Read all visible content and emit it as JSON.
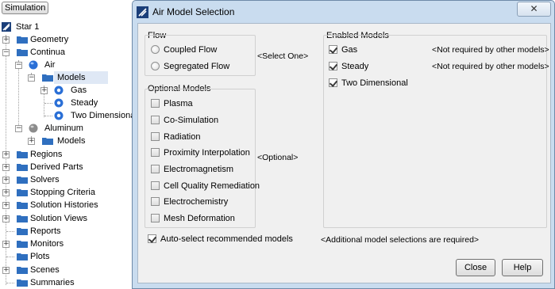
{
  "tree": {
    "sim_tab": "Simulation",
    "items": [
      {
        "label": "Star 1"
      },
      {
        "label": "Geometry"
      },
      {
        "label": "Continua"
      },
      {
        "label": "Air"
      },
      {
        "label": "Models"
      },
      {
        "label": "Gas"
      },
      {
        "label": "Steady"
      },
      {
        "label": "Two Dimensional"
      },
      {
        "label": "Aluminum"
      },
      {
        "label": "Models"
      },
      {
        "label": "Regions"
      },
      {
        "label": "Derived Parts"
      },
      {
        "label": "Solvers"
      },
      {
        "label": "Stopping Criteria"
      },
      {
        "label": "Solution Histories"
      },
      {
        "label": "Solution Views"
      },
      {
        "label": "Reports"
      },
      {
        "label": "Monitors"
      },
      {
        "label": "Plots"
      },
      {
        "label": "Scenes"
      },
      {
        "label": "Summaries"
      }
    ]
  },
  "dialog": {
    "title": "Air Model Selection",
    "close_glyph": "✕",
    "flow": {
      "title": "Flow",
      "options": [
        {
          "label": "Coupled Flow",
          "selected": false
        },
        {
          "label": "Segregated Flow",
          "selected": false
        }
      ],
      "hint": "<Select One>"
    },
    "optional": {
      "title": "Optional Models",
      "items": [
        {
          "label": "Plasma"
        },
        {
          "label": "Co-Simulation"
        },
        {
          "label": "Radiation"
        },
        {
          "label": "Proximity Interpolation"
        },
        {
          "label": "Electromagnetism"
        },
        {
          "label": "Cell Quality Remediation"
        },
        {
          "label": "Electrochemistry"
        },
        {
          "label": "Mesh Deformation"
        }
      ],
      "hint": "<Optional>"
    },
    "enabled": {
      "title": "Enabled Models",
      "items": [
        {
          "label": "Gas",
          "checked": true,
          "note": "<Not required by other models>"
        },
        {
          "label": "Steady",
          "checked": true,
          "note": "<Not required by other models>"
        },
        {
          "label": "Two Dimensional",
          "checked": true,
          "note": ""
        }
      ]
    },
    "auto_select": {
      "label": "Auto-select recommended models",
      "checked": true
    },
    "status": "<Additional model selections are required>",
    "buttons": {
      "close": "Close",
      "help": "Help"
    }
  },
  "colors": {
    "folder": "#2f6fbf",
    "sphere_air": "#2a6fd6",
    "sphere_aluminum": "#8c8c8c",
    "dialog_bg": "#c9dcef"
  }
}
